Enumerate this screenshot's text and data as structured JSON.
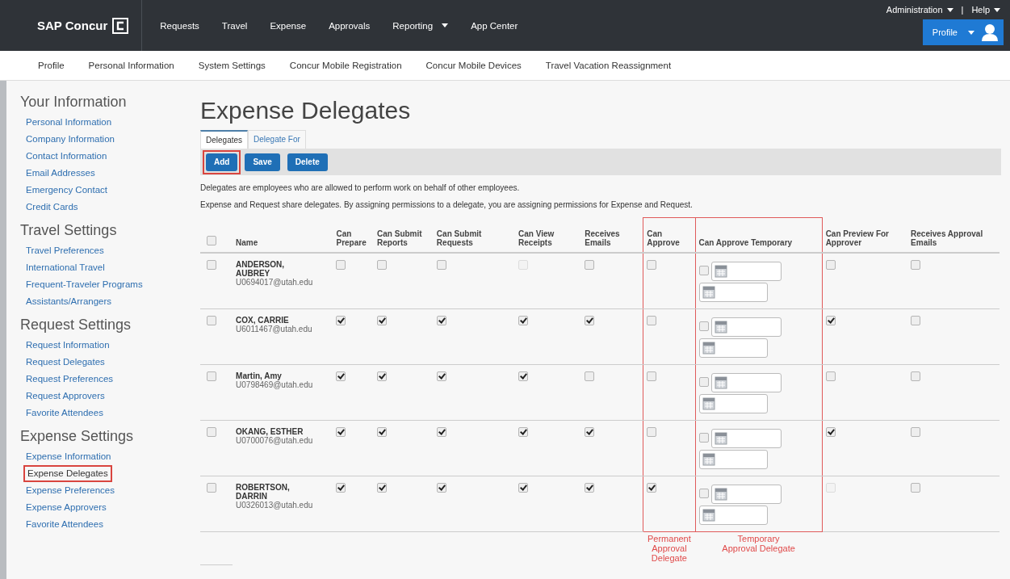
{
  "topbar": {
    "brand": "SAP Concur",
    "nav": [
      {
        "label": "Requests",
        "dropdown": false
      },
      {
        "label": "Travel",
        "dropdown": false
      },
      {
        "label": "Expense",
        "dropdown": false
      },
      {
        "label": "Approvals",
        "dropdown": false
      },
      {
        "label": "Reporting",
        "dropdown": true
      },
      {
        "label": "App Center",
        "dropdown": false
      }
    ],
    "admin": "Administration",
    "separator": "|",
    "help": "Help",
    "profile": "Profile"
  },
  "subnav": [
    "Profile",
    "Personal Information",
    "System Settings",
    "Concur Mobile Registration",
    "Concur Mobile Devices",
    "Travel Vacation Reassignment"
  ],
  "sidebar": [
    {
      "heading": "Your Information",
      "links": [
        {
          "label": "Personal Information",
          "highlighted": false
        },
        {
          "label": "Company Information",
          "highlighted": false
        },
        {
          "label": "Contact Information",
          "highlighted": false
        },
        {
          "label": "Email Addresses",
          "highlighted": false
        },
        {
          "label": "Emergency Contact",
          "highlighted": false
        },
        {
          "label": "Credit Cards",
          "highlighted": false
        }
      ]
    },
    {
      "heading": "Travel Settings",
      "links": [
        {
          "label": "Travel Preferences",
          "highlighted": false
        },
        {
          "label": "International Travel",
          "highlighted": false
        },
        {
          "label": "Frequent-Traveler Programs",
          "highlighted": false
        },
        {
          "label": "Assistants/Arrangers",
          "highlighted": false
        }
      ]
    },
    {
      "heading": "Request Settings",
      "links": [
        {
          "label": "Request Information",
          "highlighted": false
        },
        {
          "label": "Request Delegates",
          "highlighted": false
        },
        {
          "label": "Request Preferences",
          "highlighted": false
        },
        {
          "label": "Request Approvers",
          "highlighted": false
        },
        {
          "label": "Favorite Attendees",
          "highlighted": false
        }
      ]
    },
    {
      "heading": "Expense Settings",
      "links": [
        {
          "label": "Expense Information",
          "highlighted": false
        },
        {
          "label": "Expense Delegates",
          "highlighted": true
        },
        {
          "label": "Expense Preferences",
          "highlighted": false
        },
        {
          "label": "Expense Approvers",
          "highlighted": false
        },
        {
          "label": "Favorite Attendees",
          "highlighted": false
        }
      ]
    }
  ],
  "title": "Expense Delegates",
  "tabs": [
    {
      "label": "Delegates",
      "selected": true
    },
    {
      "label": "Delegate For",
      "selected": false
    }
  ],
  "buttons": [
    {
      "label": "Add",
      "highlighted": true
    },
    {
      "label": "Save",
      "highlighted": false
    },
    {
      "label": "Delete",
      "highlighted": false
    }
  ],
  "notes": [
    "Delegates are employees who are allowed to perform work on behalf of other employees.",
    "Expense and Request share delegates. By assigning permissions to a delegate, you are assigning permissions for Expense and Request."
  ],
  "table": {
    "select_all": {
      "checked": false
    },
    "columns": [
      {
        "label": "Name",
        "highlighted": false
      },
      {
        "label": "Can Prepare",
        "highlighted": false
      },
      {
        "label": "Can Submit Reports",
        "highlighted": false
      },
      {
        "label": "Can Submit Requests",
        "highlighted": false
      },
      {
        "label": "Can View Receipts",
        "highlighted": false
      },
      {
        "label": "Receives Emails",
        "highlighted": false
      },
      {
        "label": "Can Approve",
        "highlighted": true,
        "annotation": "Permanent Approval Delegate"
      },
      {
        "label": "Can Approve Temporary",
        "highlighted": true,
        "annotation": "Temporary Approval Delegate"
      },
      {
        "label": "Can Preview For Approver",
        "highlighted": false
      },
      {
        "label": "Receives Approval Emails",
        "highlighted": false
      }
    ],
    "rows": [
      {
        "selected": false,
        "name": "ANDERSON, AUBREY",
        "email": "U0694017@utah.edu",
        "permissions": [
          {
            "checked": false,
            "disabled": false
          },
          {
            "checked": false,
            "disabled": false
          },
          {
            "checked": false,
            "disabled": false
          },
          {
            "checked": false,
            "disabled": true
          },
          {
            "checked": false,
            "disabled": false
          },
          {
            "checked": false,
            "disabled": false
          },
          {
            "checked": false,
            "disabled": false
          },
          {
            "checked": false,
            "disabled": false
          }
        ],
        "temporary": {
          "checked": false
        }
      },
      {
        "selected": false,
        "name": "COX, CARRIE",
        "email": "U6011467@utah.edu",
        "permissions": [
          {
            "checked": true,
            "disabled": false
          },
          {
            "checked": true,
            "disabled": false
          },
          {
            "checked": true,
            "disabled": false
          },
          {
            "checked": true,
            "disabled": false
          },
          {
            "checked": true,
            "disabled": false
          },
          {
            "checked": false,
            "disabled": false
          },
          {
            "checked": true,
            "disabled": false
          },
          {
            "checked": false,
            "disabled": false
          }
        ],
        "temporary": {
          "checked": false
        }
      },
      {
        "selected": false,
        "name": "Martin, Amy",
        "email": "U0798469@utah.edu",
        "permissions": [
          {
            "checked": true,
            "disabled": false
          },
          {
            "checked": true,
            "disabled": false
          },
          {
            "checked": true,
            "disabled": false
          },
          {
            "checked": true,
            "disabled": false
          },
          {
            "checked": false,
            "disabled": false
          },
          {
            "checked": false,
            "disabled": false
          },
          {
            "checked": false,
            "disabled": false
          },
          {
            "checked": false,
            "disabled": false
          }
        ],
        "temporary": {
          "checked": false
        }
      },
      {
        "selected": false,
        "name": "OKANG, ESTHER",
        "email": "U0700076@utah.edu",
        "permissions": [
          {
            "checked": true,
            "disabled": false
          },
          {
            "checked": true,
            "disabled": false
          },
          {
            "checked": true,
            "disabled": false
          },
          {
            "checked": true,
            "disabled": false
          },
          {
            "checked": true,
            "disabled": false
          },
          {
            "checked": false,
            "disabled": false
          },
          {
            "checked": true,
            "disabled": false
          },
          {
            "checked": false,
            "disabled": false
          }
        ],
        "temporary": {
          "checked": false
        }
      },
      {
        "selected": false,
        "name": "ROBERTSON, DARRIN",
        "email": "U0326013@utah.edu",
        "permissions": [
          {
            "checked": true,
            "disabled": false
          },
          {
            "checked": true,
            "disabled": false
          },
          {
            "checked": true,
            "disabled": false
          },
          {
            "checked": true,
            "disabled": false
          },
          {
            "checked": true,
            "disabled": false
          },
          {
            "checked": true,
            "disabled": false
          },
          {
            "checked": false,
            "disabled": true
          },
          {
            "checked": false,
            "disabled": false
          }
        ],
        "temporary": {
          "checked": false
        }
      }
    ]
  }
}
